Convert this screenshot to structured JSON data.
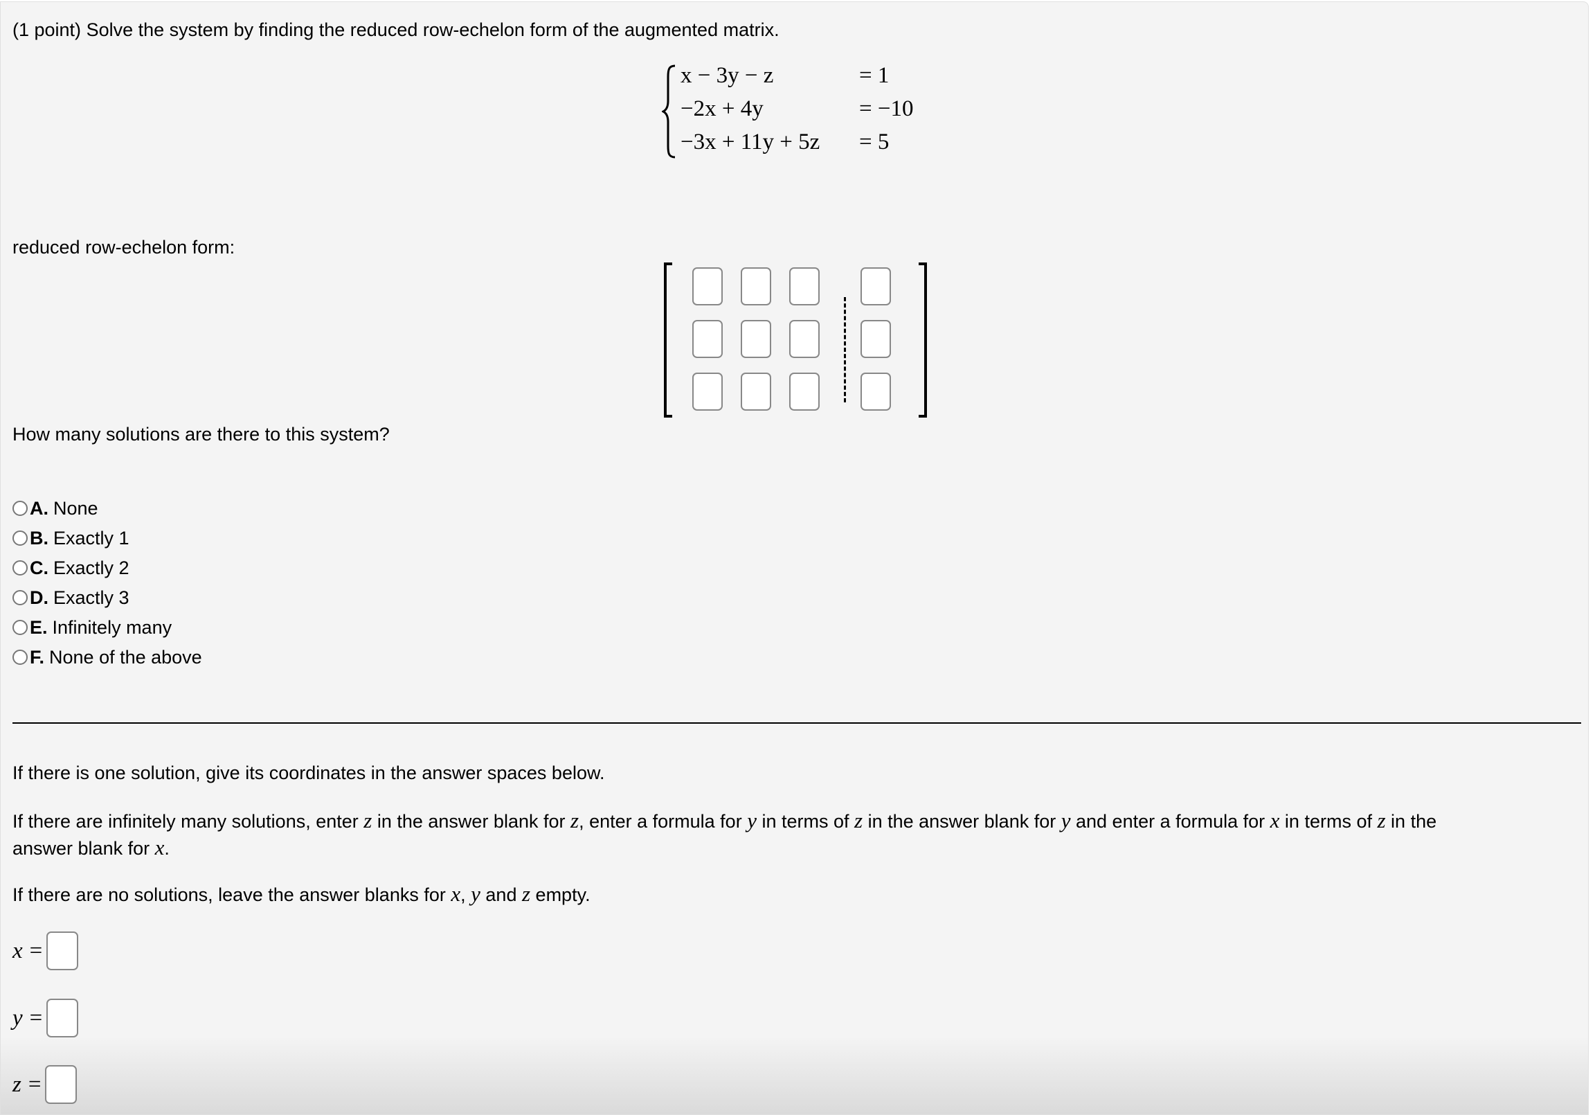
{
  "question": {
    "points": "(1 point)",
    "prompt": "Solve the system by finding the reduced row-echelon form of the augmented matrix."
  },
  "system": {
    "equations": [
      {
        "lhs": "x − 3y − z",
        "rhs": "= 1"
      },
      {
        "lhs": "−2x + 4y",
        "rhs": "= −10"
      },
      {
        "lhs": "−3x + 11y + 5z",
        "rhs": "= 5"
      }
    ]
  },
  "rref": {
    "label": "reduced row-echelon form:",
    "rows": 3,
    "cols": 4,
    "values": [
      [
        "",
        "",
        "",
        ""
      ],
      [
        "",
        "",
        "",
        ""
      ],
      [
        "",
        "",
        "",
        ""
      ]
    ]
  },
  "solutions_question": {
    "label": "How many solutions are there to this system?",
    "options": [
      {
        "letter": "A.",
        "text": "None",
        "selected": false
      },
      {
        "letter": "B.",
        "text": "Exactly 1",
        "selected": false
      },
      {
        "letter": "C.",
        "text": "Exactly 2",
        "selected": false
      },
      {
        "letter": "D.",
        "text": "Exactly 3",
        "selected": false
      },
      {
        "letter": "E.",
        "text": "Infinitely many",
        "selected": false
      },
      {
        "letter": "F.",
        "text": "None of the above",
        "selected": false
      }
    ]
  },
  "instructions": {
    "one_solution": "If there is one solution, give its coordinates in the answer spaces below.",
    "infinite": {
      "p1": "If there are infinitely many solutions, enter ",
      "v1": "z",
      "p2": " in the answer blank for ",
      "v2": "z",
      "p3": ", enter a formula for ",
      "v3": "y",
      "p4": " in terms of ",
      "v4": "z",
      "p5": " in the answer blank for ",
      "v5": "y",
      "p6": " and enter a formula for ",
      "v6": "x",
      "p7": " in terms of ",
      "v7": "z",
      "p8": " in the",
      "line2a": "answer blank for ",
      "v8": "x",
      "line2b": "."
    },
    "no_solution": {
      "p1": "If there are no solutions, leave the answer blanks for ",
      "v1": "x",
      "p2": ", ",
      "v2": "y",
      "p3": " and ",
      "v3": "z",
      "p4": " empty."
    }
  },
  "answers": [
    {
      "var": "x",
      "eq": "=",
      "value": ""
    },
    {
      "var": "y",
      "eq": "=",
      "value": ""
    },
    {
      "var": "z",
      "eq": "=",
      "value": ""
    }
  ]
}
